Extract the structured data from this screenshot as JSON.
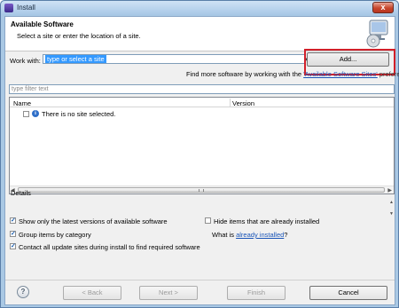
{
  "window": {
    "title": "Install",
    "close_label": "x"
  },
  "header": {
    "title": "Available Software",
    "description": "Select a site or enter the location of a site."
  },
  "work_with": {
    "label": "Work with:",
    "value": "type or select a site",
    "add_label": "Add...",
    "find_more_text": "Find more software by working with the ",
    "find_more_link": "'Available Software Sites'",
    "find_more_suffix": " preferences."
  },
  "filter": {
    "placeholder": "type filter text"
  },
  "table": {
    "columns": [
      "Name",
      "Version"
    ],
    "rows": [
      {
        "text": "There is no site selected.",
        "checked": false,
        "icon": "info-icon"
      }
    ]
  },
  "details": {
    "label": "Details"
  },
  "options": {
    "latest_versions": {
      "label": "Show only the latest versions of available software",
      "checked": true
    },
    "hide_installed": {
      "label": "Hide items that are already installed",
      "checked": false
    },
    "group_category": {
      "label": "Group items by category",
      "checked": true
    },
    "what_is_prefix": "What is ",
    "already_installed_link": "already installed",
    "what_is_suffix": "?",
    "contact_sites": {
      "label": "Contact all update sites during install to find required software",
      "checked": true
    }
  },
  "buttons": {
    "help": "?",
    "back": "< Back",
    "next": "Next >",
    "finish": "Finish",
    "cancel": "Cancel"
  },
  "colors": {
    "title_bar": "#a7c7e6",
    "selection": "#3399ff",
    "link": "#1a55b8",
    "highlight_box": "#d1202a"
  }
}
